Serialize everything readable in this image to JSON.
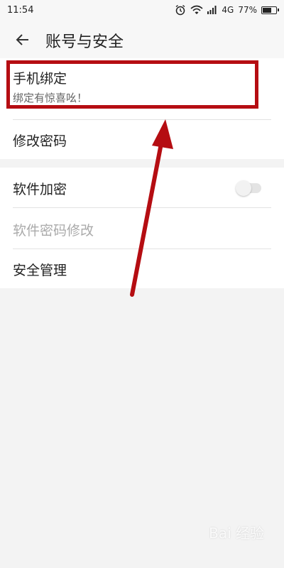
{
  "status_bar": {
    "time": "11:54",
    "network": "4G",
    "battery_text": "77%",
    "battery_level": 0.77,
    "icons": [
      "alarm-icon",
      "wifi-icon",
      "signal-icon",
      "battery-icon"
    ]
  },
  "header": {
    "title": "账号与安全",
    "back_icon": "back-arrow-icon"
  },
  "group1": [
    {
      "label": "手机绑定",
      "sub": "绑定有惊喜吆！"
    },
    {
      "label": "修改密码"
    }
  ],
  "group2": [
    {
      "label": "软件加密",
      "toggle_on": false
    },
    {
      "label": "软件密码修改",
      "disabled": true
    },
    {
      "label": "安全管理"
    }
  ],
  "watermark": "Bai 经验",
  "colors": {
    "annotation": "#b50d12",
    "background": "#f3f3f3"
  }
}
